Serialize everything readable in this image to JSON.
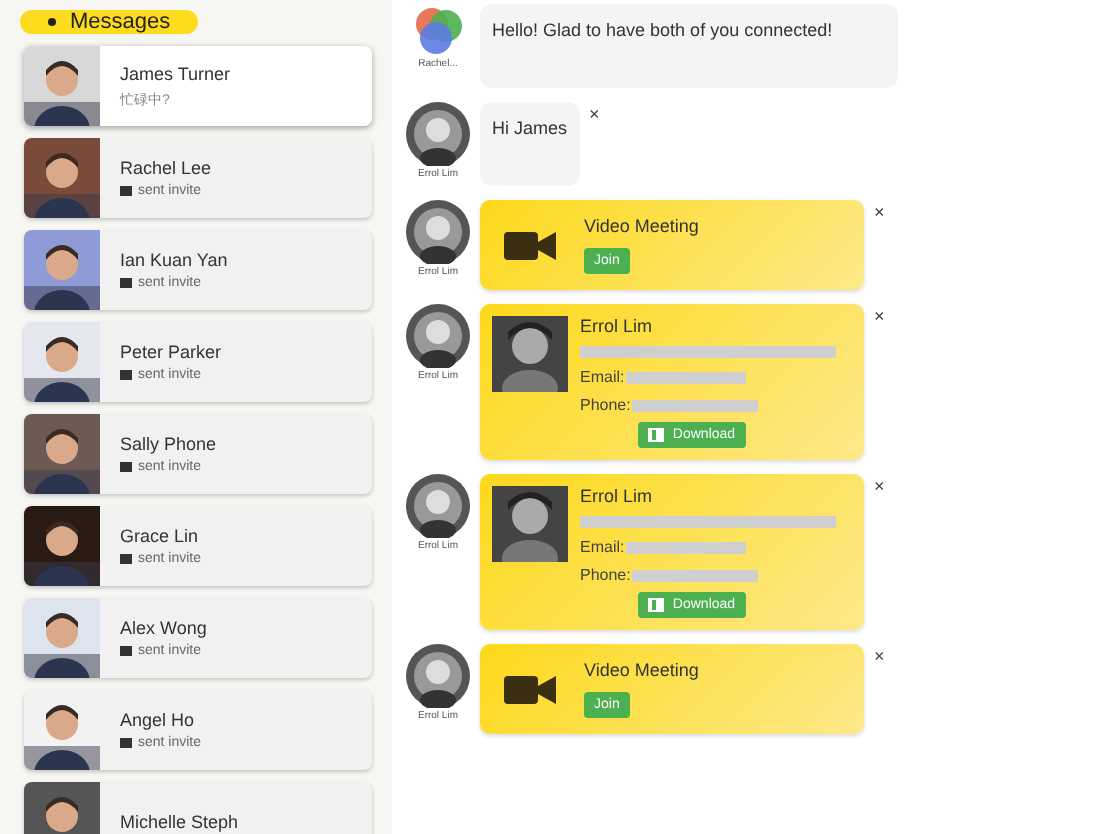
{
  "header": {
    "button": "Messages"
  },
  "contacts": [
    {
      "name": "James Turner",
      "status": "忙碌中?",
      "selected": true
    },
    {
      "name": "Rachel Lee",
      "status": "sent invite",
      "selected": false
    },
    {
      "name": "Ian Kuan Yan",
      "status": "sent invite",
      "selected": false
    },
    {
      "name": "Peter Parker",
      "status": "sent invite",
      "selected": false
    },
    {
      "name": "Sally Phone",
      "status": "sent invite",
      "selected": false
    },
    {
      "name": "Grace Lin",
      "status": "sent invite",
      "selected": false
    },
    {
      "name": "Alex Wong",
      "status": "sent invite",
      "selected": false
    },
    {
      "name": "Angel Ho",
      "status": "sent invite",
      "selected": false
    },
    {
      "name": "Michelle Steph",
      "selected": false
    }
  ],
  "messages": [
    {
      "kind": "text",
      "sender": "Rachel...",
      "text": "Hello! Glad to have both of you connected!"
    },
    {
      "kind": "text",
      "sender": "Errol Lim",
      "text": "Hi James",
      "close": "×"
    },
    {
      "kind": "video",
      "sender": "Errol Lim",
      "title": "Video Meeting",
      "button": "Join",
      "close": "×"
    },
    {
      "kind": "contact",
      "sender": "Errol Lim",
      "name": "Errol Lim",
      "email": "Email:",
      "phone": "Phone:",
      "button": "Download",
      "close": "×"
    },
    {
      "kind": "contact",
      "sender": "Errol Lim",
      "name": "Errol Lim",
      "email": "Email:",
      "phone": "Phone:",
      "button": "Download",
      "close": "×"
    },
    {
      "kind": "video",
      "sender": "Errol Lim",
      "title": "Video Meeting",
      "button": "Join",
      "close": "×"
    }
  ]
}
